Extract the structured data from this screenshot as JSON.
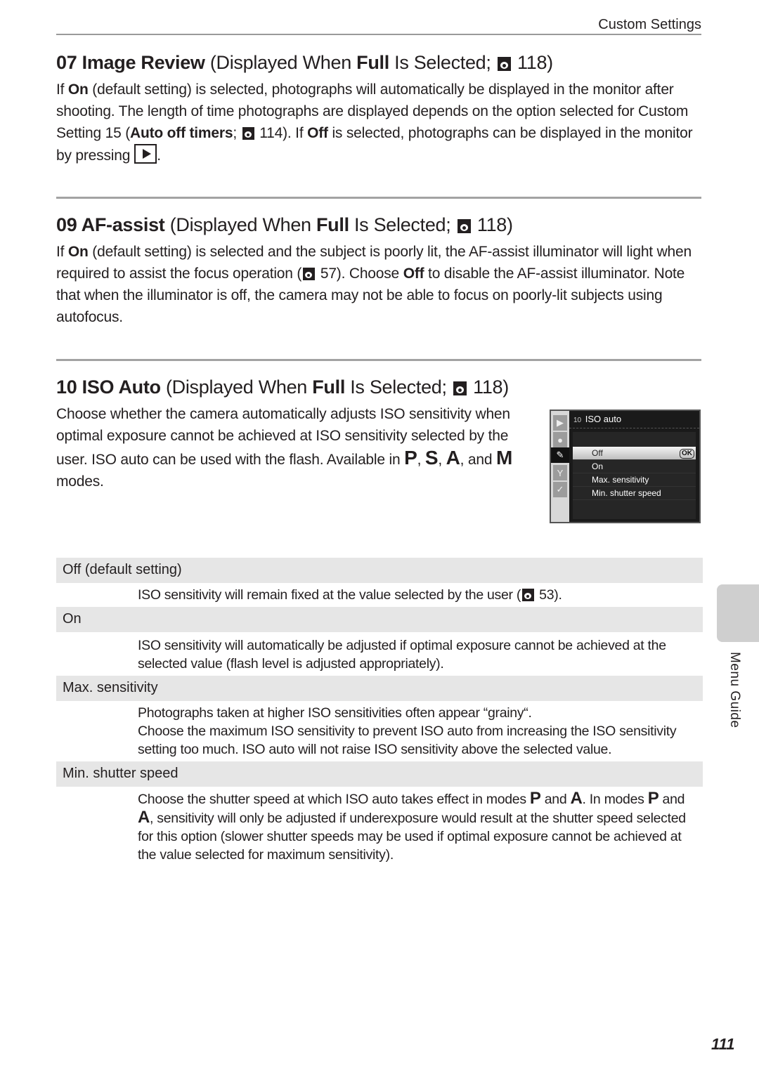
{
  "header": {
    "title": "Custom Settings"
  },
  "sections": [
    {
      "num_name": "07 Image Review",
      "paren_pre": "(Displayed When ",
      "paren_bold": "Full",
      "paren_mid": " Is Selected; ",
      "paren_ref": "118)",
      "body": {
        "t1": "If ",
        "b1": "On",
        "t2": " (default setting) is selected, photographs will automatically be displayed in the monitor after shooting. The length of time photographs are displayed depends on the option selected for Custom Setting 15 (",
        "b2": "Auto off timers",
        "t3": "; ",
        "t4": " 114). If ",
        "b3": "Off",
        "t5": " is selected, photographs can be displayed in the monitor by pressing",
        "t6": "."
      }
    },
    {
      "num_name": "09 AF-assist",
      "paren_pre": "(Displayed When ",
      "paren_bold": "Full",
      "paren_mid": " Is Selected; ",
      "paren_ref": "118)",
      "body": {
        "t1": "If ",
        "b1": "On",
        "t2": " (default setting) is selected and the subject is poorly lit, the AF-assist illuminator will light when required to assist the focus operation (",
        "t3": " 57). Choose ",
        "b2": "Off",
        "t4": " to disable the AF-assist illuminator. Note that when the illuminator is off, the camera may not be able to focus on poorly-lit subjects using autofocus."
      }
    },
    {
      "num_name": "10 ISO Auto",
      "paren_pre": "(Displayed When ",
      "paren_bold": "Full",
      "paren_mid": " Is Selected; ",
      "paren_ref": "118)",
      "body": {
        "t1": "Choose whether the camera automatically adjusts ISO sensitivity when optimal exposure cannot be achieved at ISO sensitivity selected by the user. ISO auto can be used with the flash. Available in ",
        "m1": "P",
        "c1": ", ",
        "m2": "S",
        "c2": ", ",
        "m3": "A",
        "c3": ", and ",
        "m4": "M",
        "t2": " modes."
      }
    }
  ],
  "camera_screen": {
    "menu_number": "10",
    "menu_title": "ISO auto",
    "tabs": [
      "playback-icon",
      "camera-icon",
      "pencil-icon",
      "wrench-icon",
      "brush-icon"
    ],
    "active_tab": 2,
    "items": [
      "Off",
      "On",
      "Max. sensitivity",
      "Min. shutter speed"
    ],
    "selected_index": 0,
    "ok_label": "OK"
  },
  "options_table": [
    {
      "label": "Off (default setting)",
      "desc_pre": "ISO sensitivity will remain fixed at the value selected by the user (",
      "desc_post": " 53)."
    },
    {
      "label": "On",
      "desc": "ISO sensitivity will automatically be adjusted if optimal exposure cannot be achieved at the selected value (flash level is adjusted appropriately)."
    },
    {
      "label": "Max. sensitivity",
      "desc_l1": "Photographs taken at higher ISO sensitivities often appear “grainy“.",
      "desc_l2": "Choose the maximum ISO sensitivity to prevent ISO auto from increasing the ISO sensitivity setting too much. ISO auto will not raise ISO sensitivity above the selected value."
    },
    {
      "label": "Min. shutter speed",
      "d1": "Choose the shutter speed at which ISO auto takes effect in modes ",
      "m1": "P",
      "d2": " and ",
      "m2": "A",
      "d3": ". In modes ",
      "m3": "P",
      "d4": " and ",
      "m4": "A",
      "d5": ", sensitivity will only be adjusted if underexposure would result at the shutter speed selected for this option (slower shutter speeds may be used if optimal exposure cannot be achieved at the value selected for maximum sensitivity)."
    }
  ],
  "side_tab": {
    "label": "Menu Guide"
  },
  "page_number": "111"
}
